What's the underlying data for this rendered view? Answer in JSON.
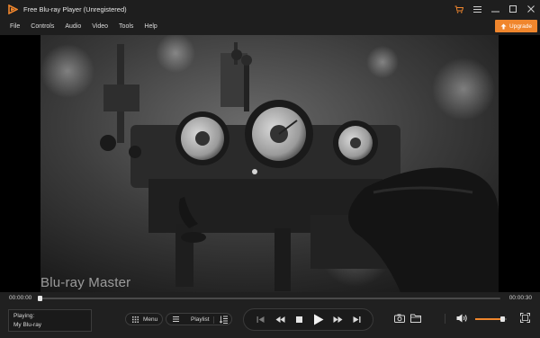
{
  "window": {
    "title": "Free Blu-ray Player (Unregistered)",
    "controls": [
      "cart-icon",
      "menu-icon",
      "minimize-icon",
      "maximize-icon",
      "close-icon"
    ]
  },
  "menu": {
    "items": [
      {
        "label": "File"
      },
      {
        "label": "Controls"
      },
      {
        "label": "Audio"
      },
      {
        "label": "Video"
      },
      {
        "label": "Tools"
      },
      {
        "label": "Help"
      }
    ],
    "upgrade_label": "Upgrade"
  },
  "video": {
    "watermark": "Blu-ray Master"
  },
  "playback": {
    "current_time": "00:00:00",
    "total_time": "00:00:30",
    "progress": 0.0,
    "volume": 0.8
  },
  "now_playing": {
    "label": "Playing:",
    "title": "My Blu-ray"
  },
  "buttons": {
    "menu_label": "Menu",
    "playlist_label": "Playlist"
  },
  "colors": {
    "accent": "#f0862d",
    "background": "#202020",
    "titlebar": "#1e1e1e"
  }
}
